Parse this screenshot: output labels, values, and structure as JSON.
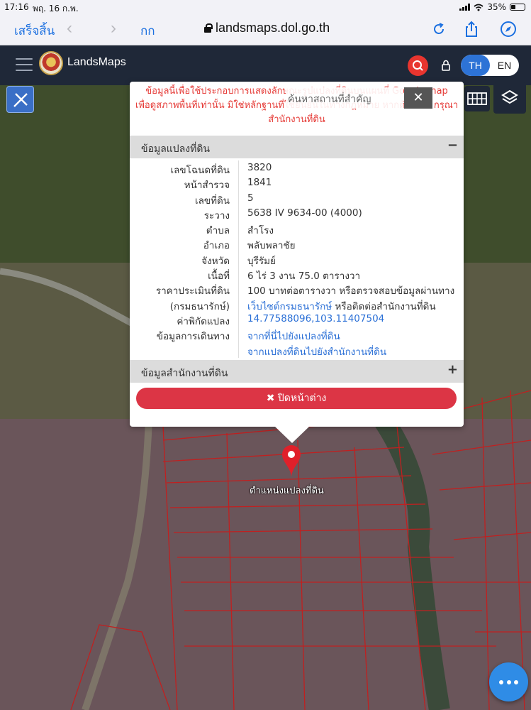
{
  "status_bar": {
    "time": "17:16",
    "date": "พฤ. 16 ก.พ.",
    "battery": "35%"
  },
  "browser": {
    "done_label": "เสร็จสิ้น",
    "text_size_label": "กก",
    "url": "landsmaps.dol.go.th"
  },
  "app": {
    "title": "LandsMaps",
    "lang_th": "TH",
    "lang_en": "EN"
  },
  "search": {
    "placeholder": "ค้นหาสถานที่สำคัญ",
    "close_label": "✕"
  },
  "popup": {
    "notice_line1": "ข้อมูลนี้เพื่อใช้ประกอบการแสดงลักษณะรูปแปลงที่ดินบนแผนที่ Google map",
    "notice_line2": "เพื่อดูสภาพพื้นที่เท่านั้น มิใช่หลักฐานที่ใช้ยืนยันในทางกฎหมาย หากต้องการ กรุณาติดต่อ",
    "notice_line3": "สำนักงานที่ดิน",
    "section_parcel": "ข้อมูลแปลงที่ดิน",
    "section_parcel_toggle": "−",
    "section_office": "ข้อมูลสำนักงานที่ดิน",
    "section_office_toggle": "+",
    "close_button": "✖ ปิดหน้าต่าง",
    "rows": [
      {
        "key": "เลขโฉนดที่ดิน",
        "value": "3820",
        "link": false
      },
      {
        "key": "หน้าสำรวจ",
        "value": "1841",
        "link": false
      },
      {
        "key": "เลขที่ดิน",
        "value": "5",
        "link": false
      },
      {
        "key": "ระวาง",
        "value": "5638 IV 9634-00 (4000)",
        "link": false
      },
      {
        "key": "ตำบล",
        "value": "สำโรง",
        "link": false
      },
      {
        "key": "อำเภอ",
        "value": "พลับพลาชัย",
        "link": false
      },
      {
        "key": "จังหวัด",
        "value": "บุรีรัมย์",
        "link": false
      },
      {
        "key": "เนื้อที่",
        "value": "6 ไร่ 3 งาน 75.0 ตารางวา",
        "link": false
      },
      {
        "key": "ราคาประเมินที่ดิน",
        "value": "100 บาทต่อตารางวา หรือตรวจสอบข้อมูลผ่านทาง",
        "link": false
      },
      {
        "key": "(กรมธนารักษ์)",
        "value": "เว็บไซต์กรมธนารักษ์",
        "value_suffix": " หรือติดต่อสำนักงานที่ดิน",
        "link": true
      },
      {
        "key": "ค่าพิกัดแปลง",
        "value": "14.77588096,103.11407504",
        "link": true
      },
      {
        "key": "ข้อมูลการเดินทาง",
        "value": "จากที่นี่ไปยังแปลงที่ดิน",
        "link": true
      },
      {
        "key": "",
        "value": "จากแปลงที่ดินไปยังสำนักงานที่ดิน",
        "link": true
      }
    ]
  },
  "map": {
    "pin_label": "ตำแหน่งแปลงที่ดิน"
  }
}
